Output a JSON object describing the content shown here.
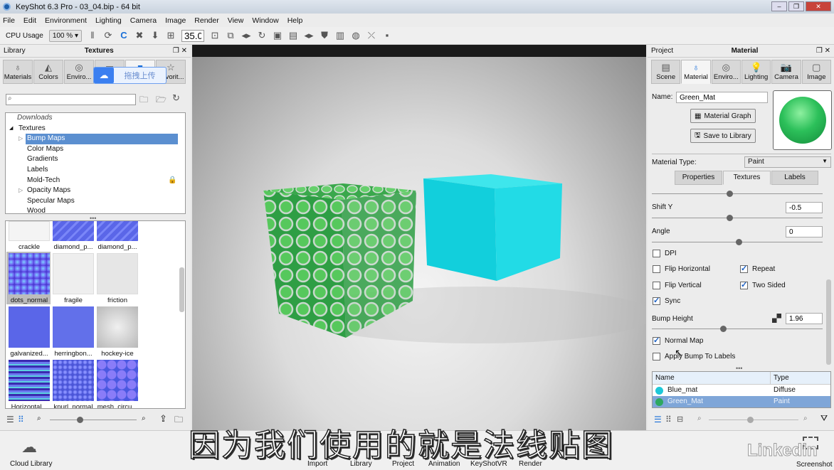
{
  "window": {
    "title": "KeyShot 6.3 Pro  - 03_04.bip  - 64 bit"
  },
  "menu": [
    "File",
    "Edit",
    "Environment",
    "Lighting",
    "Camera",
    "Image",
    "Render",
    "View",
    "Window",
    "Help"
  ],
  "toolbar": {
    "cpu_label": "CPU Usage",
    "cpu_value": "100 %",
    "fov_value": "35.0"
  },
  "library": {
    "header_left": "Library",
    "header_title": "Textures",
    "tabs": [
      "Materials",
      "Colors",
      "Enviro...",
      "",
      "",
      "Favorit..."
    ],
    "search_placeholder": "",
    "tree": [
      "Downloads",
      "Textures",
      "Bump Maps",
      "Color Maps",
      "Gradients",
      "Labels",
      "Mold-Tech",
      "Opacity Maps",
      "Specular Maps",
      "Wood"
    ],
    "thumbs": [
      "crackle",
      "diamond_p...",
      "diamond_p...",
      "dots_normal",
      "fragile",
      "friction",
      "galvanized...",
      "herringbon...",
      "hockey-ice",
      "Horizontal...",
      "knurl_normal",
      "mesh_circu..."
    ],
    "cloud_library": "Cloud Library"
  },
  "upload_overlay": "拖拽上传",
  "project": {
    "header_left": "Project",
    "header_title": "Material",
    "tabs": [
      "Scene",
      "Material",
      "Enviro...",
      "Lighting",
      "Camera",
      "Image"
    ],
    "name_label": "Name:",
    "name_value": "Green_Mat",
    "material_graph": "Material Graph",
    "save_to_library": "Save to Library",
    "material_type_label": "Material Type:",
    "material_type_value": "Paint",
    "subtabs": [
      "Properties",
      "Textures",
      "Labels"
    ],
    "shift_y_label": "Shift Y",
    "shift_y_value": "-0.5",
    "angle_label": "Angle",
    "angle_value": "0",
    "dpi": "DPI",
    "flip_h": "Flip Horizontal",
    "repeat": "Repeat",
    "flip_v": "Flip Vertical",
    "two_sided": "Two Sided",
    "sync": "Sync",
    "bump_height_label": "Bump Height",
    "bump_height_value": "1.96",
    "normal_map": "Normal Map",
    "apply_bump": "Apply Bump To Labels",
    "checks": {
      "dpi": false,
      "flip_h": false,
      "repeat": true,
      "flip_v": false,
      "two_sided": true,
      "sync": true,
      "normal_map": true,
      "apply_bump": false
    },
    "table_headers": [
      "Name",
      "Type"
    ],
    "materials": [
      {
        "name": "Blue_mat",
        "type": "Diffuse",
        "color": "#1ec8d8"
      },
      {
        "name": "Green_Mat",
        "type": "Paint",
        "color": "#2ea860"
      }
    ]
  },
  "bottom": [
    "Import",
    "Library",
    "Project",
    "Animation",
    "KeyShotVR",
    "Render"
  ],
  "screenshot": "Screenshot",
  "watermark": "Linkedin",
  "subtitle": "因为我们使用的就是法线贴图"
}
